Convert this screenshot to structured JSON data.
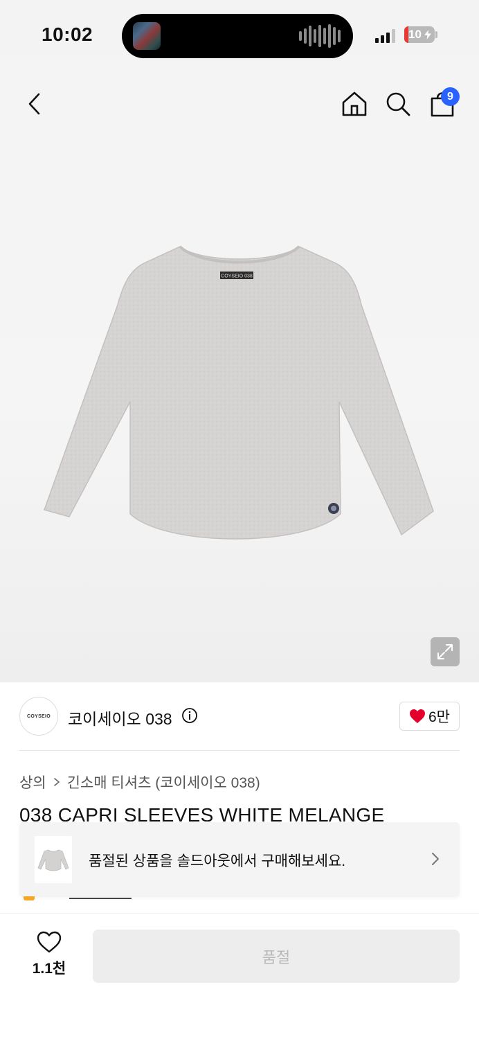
{
  "status_bar": {
    "time": "10:02",
    "battery": "10"
  },
  "nav": {
    "back_icon": "chevron-left-icon",
    "home_icon": "home-icon",
    "search_icon": "search-icon",
    "cart_icon": "shopping-bag-icon",
    "cart_count": "9",
    "accent_color": "#2962ff"
  },
  "product_image": {
    "label_text": "COYSEIO 038"
  },
  "brand": {
    "logo_text": "COYSEIO",
    "name": "코이세이오 038",
    "like_count": "6만",
    "heart_color": "#e4002b"
  },
  "breadcrumb": {
    "category": "상의",
    "subcategory": "긴소매 티셔츠 (코이세이오 038)"
  },
  "product": {
    "title": "038 CAPRI SLEEVES WHITE MELANGE"
  },
  "soldout_banner": {
    "text": "품절된 상품을 솔드아웃에서 구매해보세요."
  },
  "bottom_bar": {
    "wish_count": "1.1천",
    "buy_label": "품절"
  }
}
